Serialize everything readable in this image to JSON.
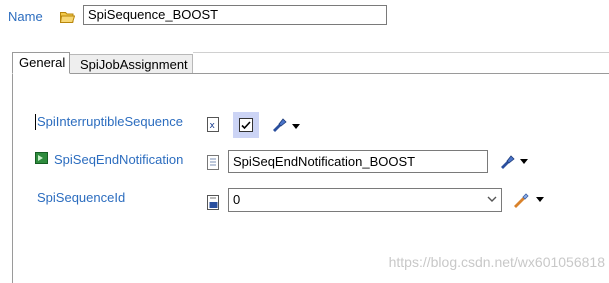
{
  "header": {
    "name_label": "Name",
    "name_value": "SpiSequence_BOOST"
  },
  "tabs": [
    {
      "label": "General",
      "active": true
    },
    {
      "label": "SpiJobAssignment",
      "active": false
    }
  ],
  "fields": {
    "interruptible": {
      "label": "SpiInterruptibleSequence",
      "checked": true
    },
    "end_notification": {
      "label": "SpiSeqEndNotification",
      "value": "SpiSeqEndNotification_BOOST"
    },
    "sequence_id": {
      "label": "SpiSequenceId",
      "value": "0"
    }
  },
  "watermark": "https://blog.csdn.net/wx601056818",
  "colors": {
    "label_blue": "#2c6dbf",
    "check_highlight": "#ccd4f5"
  }
}
